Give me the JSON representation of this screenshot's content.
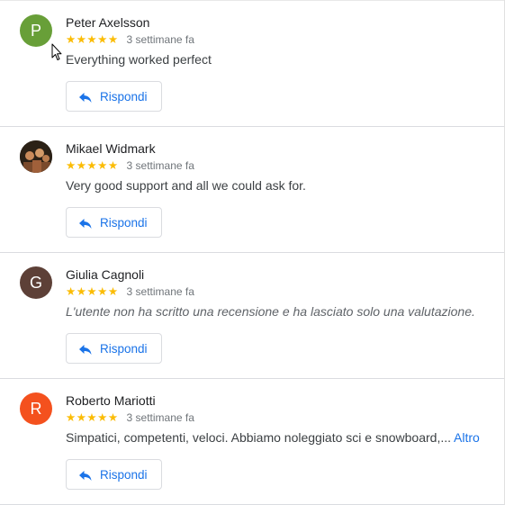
{
  "reviews": [
    {
      "author": "Peter Axelsson",
      "avatar_letter": "P",
      "avatar_color": "#689f38",
      "stars": "★★★★★",
      "rating": 5,
      "time": "3 settimane fa",
      "text": "Everything worked perfect",
      "reply_label": "Rispondi"
    },
    {
      "author": "Mikael Widmark",
      "avatar_letter": "",
      "avatar_color": "#2b2116",
      "stars": "★★★★★",
      "rating": 5,
      "time": "3 settimane fa",
      "text": "Very good support and all we could ask for.",
      "reply_label": "Rispondi"
    },
    {
      "author": "Giulia Cagnoli",
      "avatar_letter": "G",
      "avatar_color": "#5d4037",
      "stars": "★★★★★",
      "rating": 5,
      "time": "3 settimane fa",
      "text": "L'utente non ha scritto una recensione e ha lasciato solo una valutazione.",
      "reply_label": "Rispondi"
    },
    {
      "author": "Roberto Mariotti",
      "avatar_letter": "R",
      "avatar_color": "#f4511e",
      "stars": "★★★★★",
      "rating": 5,
      "time": "3 settimane fa",
      "text": "Simpatici, competenti, veloci. Abbiamo noleggiato sci e snowboard,...",
      "more_label": "Altro",
      "reply_label": "Rispondi"
    }
  ],
  "colors": {
    "star": "#fbbc04",
    "link": "#1a73e8"
  },
  "icons": {
    "reply": "reply-arrow-icon",
    "cursor": "mouse-pointer-icon"
  }
}
